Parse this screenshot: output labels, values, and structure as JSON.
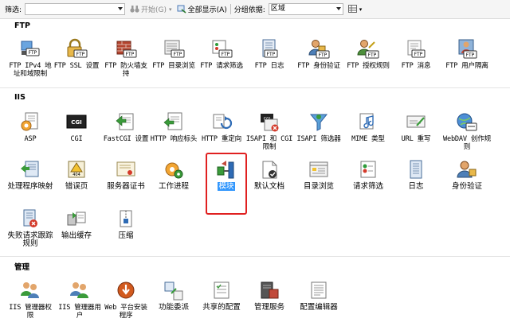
{
  "toolbar": {
    "filter_label": "筛选:",
    "start_label": "开始(G)",
    "show_all_label": "全部显示(A)",
    "group_by_label": "分组依据:",
    "group_by_value": "区域"
  },
  "sections": {
    "ftp": "FTP",
    "iis": "IIS",
    "manage": "管理"
  },
  "features": {
    "ftp_ipv4": "FTP IPv4 地址和域限制",
    "ftp_ssl": "FTP SSL 设置",
    "ftp_firewall": "FTP 防火墙支持",
    "ftp_dirbrowse": "FTP 目录浏览",
    "ftp_request_filter": "FTP 请求筛选",
    "ftp_log": "FTP 日志",
    "ftp_auth": "FTP 身份验证",
    "ftp_authz": "FTP 授权规则",
    "ftp_message": "FTP 消息",
    "ftp_user_isolation": "FTP 用户隔离",
    "asp": "ASP",
    "cgi": "CGI",
    "fastcgi": "FastCGI 设置",
    "http_headers": "HTTP 响应标头",
    "http_redirect": "HTTP 重定向",
    "isapi_cgi": "ISAPI 和 CGI 限制",
    "isapi_filters": "ISAPI 筛选器",
    "mime": "MIME 类型",
    "url_rewrite": "URL 重写",
    "webdav": "WebDAV 创作规则",
    "handler_mappings": "处理程序映射",
    "error_pages": "错误页",
    "server_certs": "服务器证书",
    "worker_processes": "工作进程",
    "modules": "模块",
    "default_doc": "默认文档",
    "dir_browse": "目录浏览",
    "request_filter": "请求筛选",
    "logging": "日志",
    "authentication": "身份验证",
    "failed_request_tracing": "失败请求跟踪规则",
    "output_caching": "输出缓存",
    "compression": "压缩",
    "iis_manager_perms": "IIS 管理器权限",
    "iis_manager_users": "IIS 管理器用户",
    "web_platform": "Web 平台安装程序",
    "feature_delegation": "功能委派",
    "shared_config": "共享的配置",
    "management_service": "管理服务",
    "config_editor": "配置编辑器"
  },
  "cgi_icon_text": "CGI",
  "ftp_badge": "FTP",
  "error_badge": "404",
  "colors": {
    "selection": "#3297fd",
    "highlight": "#e02020"
  },
  "selected_feature": "modules"
}
